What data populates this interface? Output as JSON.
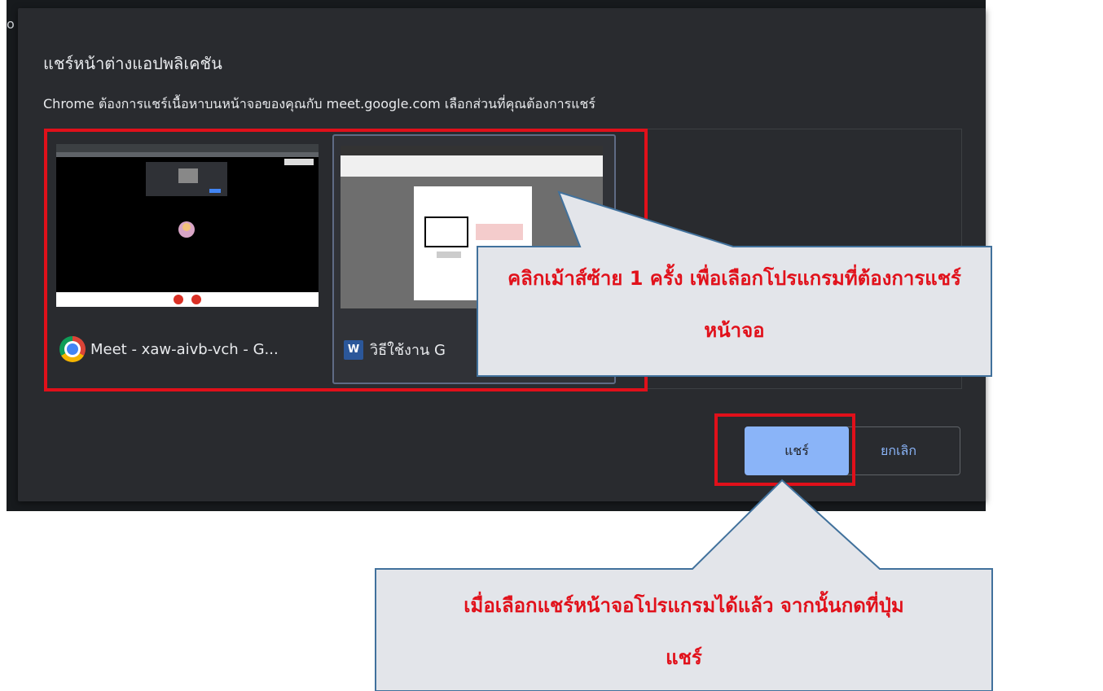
{
  "dialog": {
    "edge_glyph": "o",
    "title": "แชร์หน้าต่างแอปพลิเคชัน",
    "subtitle": "Chrome ต้องการแชร์เนื้อหาบนหน้าจอของคุณกับ meet.google.com เลือกส่วนที่คุณต้องการแชร์",
    "tiles": [
      {
        "label": "Meet - xaw-aivb-vch - G...",
        "icon": "chrome-icon"
      },
      {
        "label": "วิธีใช้งาน G",
        "icon": "word-icon"
      }
    ],
    "share_label": "แชร์",
    "cancel_label": "ยกเลิก"
  },
  "callouts": {
    "top": {
      "line1": "คลิกเม้าส์ซ้าย 1 ครั้ง เพื่อเลือกโปรแกรมที่ต้องการแชร์",
      "line2": "หน้าจอ"
    },
    "bottom": {
      "line1": "เมื่อเลือกแชร์หน้าจอโปรแกรมได้แล้ว จากนั้นกดที่ปุ่ม",
      "line2": "แชร์"
    }
  },
  "colors": {
    "highlight": "#e0101a",
    "callout_text": "#e1111b",
    "share_button": "#8ab4f8"
  }
}
